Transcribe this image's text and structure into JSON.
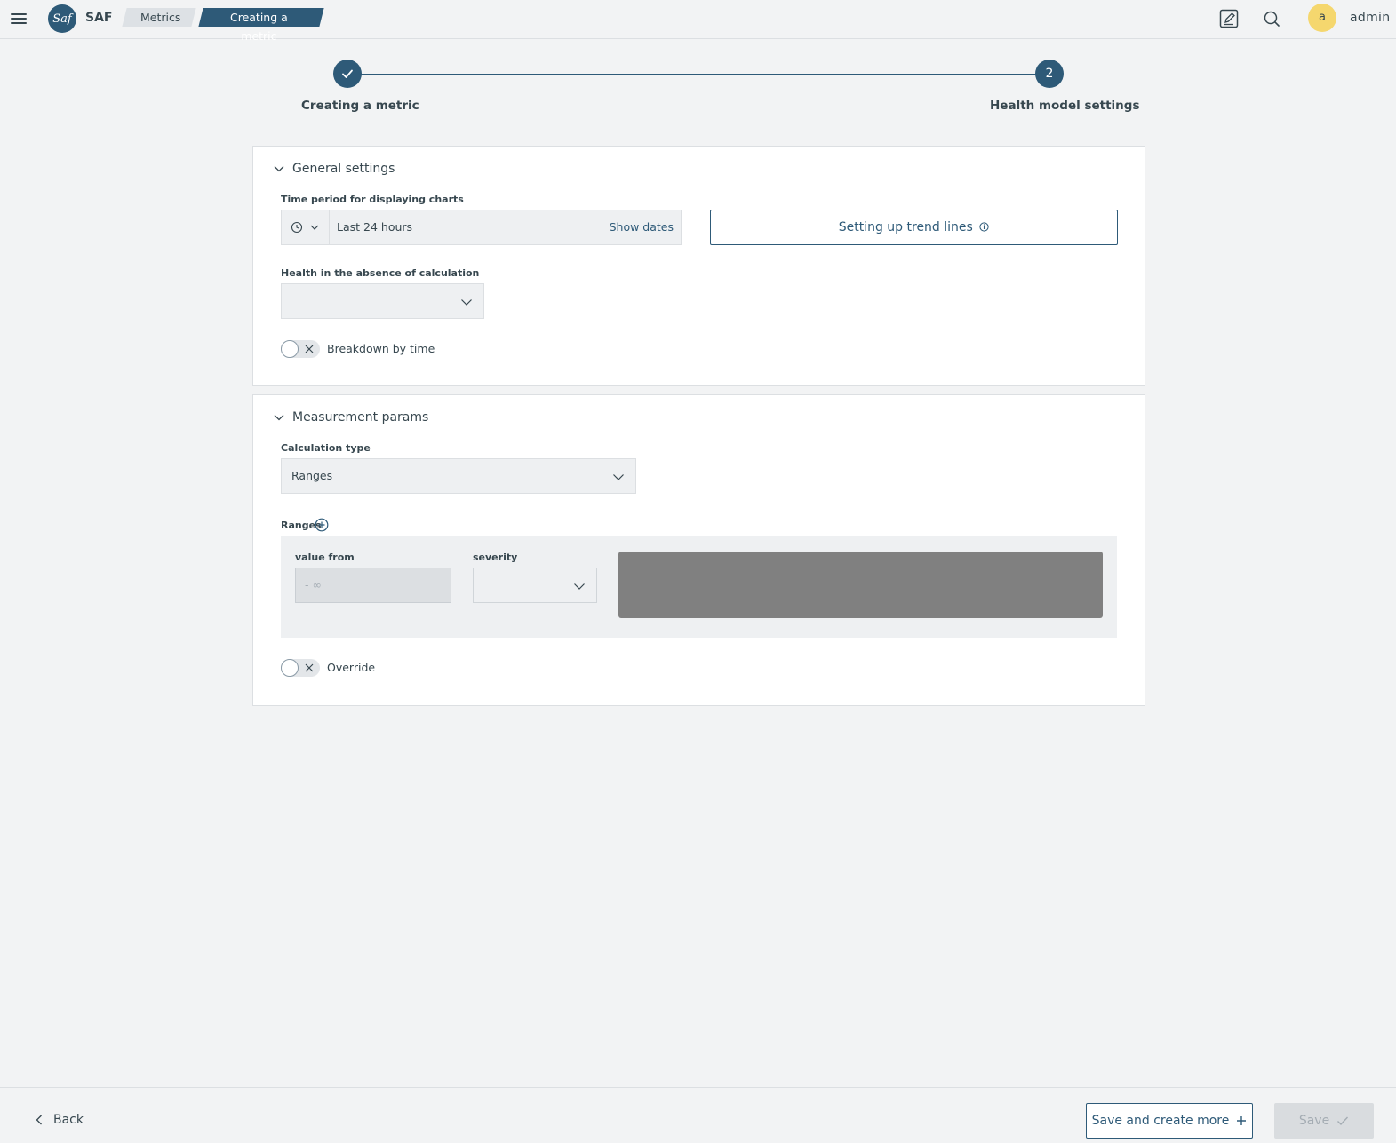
{
  "header": {
    "logo_text": "Saf",
    "app_name": "SAF",
    "breadcrumbs": [
      "Metrics",
      "Creating a metric"
    ],
    "user": {
      "avatar_letter": "a",
      "name": "admin"
    }
  },
  "stepper": {
    "steps": [
      {
        "label": "Creating a metric",
        "state": "done"
      },
      {
        "label": "Health model settings",
        "number": "2",
        "state": "active"
      }
    ]
  },
  "general_settings": {
    "title": "General settings",
    "time_period_label": "Time period for displaying charts",
    "time_period_value": "Last 24 hours",
    "show_dates_label": "Show dates",
    "trend_lines_button": "Setting up trend lines",
    "health_absence_label": "Health in the absence of calculation",
    "health_absence_value": "",
    "breakdown_label": "Breakdown by time",
    "breakdown_enabled": false
  },
  "measurement_params": {
    "title": "Measurement params",
    "calc_type_label": "Calculation type",
    "calc_type_value": "Ranges",
    "ranges_label": "Ranges",
    "range_row": {
      "value_from_label": "value from",
      "value_from_placeholder": "- ∞",
      "severity_label": "severity",
      "severity_value": "",
      "color": "#808080"
    },
    "override_label": "Override",
    "override_enabled": false
  },
  "footer": {
    "back_label": "Back",
    "save_more_label": "Save and create more",
    "save_label": "Save"
  },
  "colors": {
    "accent": "#2e5a78",
    "avatar": "#f5d76e",
    "background": "#f2f3f4"
  }
}
